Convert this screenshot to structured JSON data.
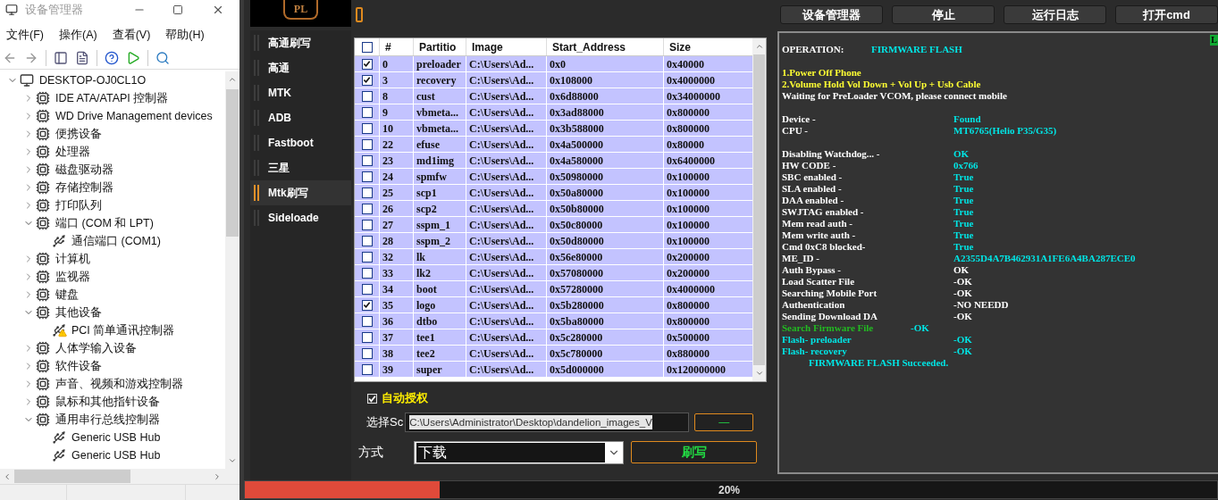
{
  "device_manager": {
    "title": "设备管理器",
    "menu": [
      "文件(F)",
      "操作(A)",
      "查看(V)",
      "帮助(H)"
    ],
    "tree": [
      {
        "label": "DESKTOP-OJ0CL1O",
        "kind": "root",
        "expanded": true,
        "children": [
          {
            "label": "IDE ATA/ATAPI 控制器",
            "kind": "group",
            "expanded": false
          },
          {
            "label": "WD Drive Management devices",
            "kind": "group",
            "expanded": false
          },
          {
            "label": "便携设备",
            "kind": "group",
            "expanded": false
          },
          {
            "label": "处理器",
            "kind": "group",
            "expanded": false
          },
          {
            "label": "磁盘驱动器",
            "kind": "group",
            "expanded": false
          },
          {
            "label": "存储控制器",
            "kind": "group",
            "expanded": false
          },
          {
            "label": "打印队列",
            "kind": "group",
            "expanded": false
          },
          {
            "label": "端口 (COM 和 LPT)",
            "kind": "group",
            "expanded": true,
            "children": [
              {
                "label": "通信端口 (COM1)",
                "kind": "device",
                "warning": false
              }
            ]
          },
          {
            "label": "计算机",
            "kind": "group",
            "expanded": false
          },
          {
            "label": "监视器",
            "kind": "group",
            "expanded": false
          },
          {
            "label": "键盘",
            "kind": "group",
            "expanded": false
          },
          {
            "label": "其他设备",
            "kind": "group",
            "expanded": true,
            "children": [
              {
                "label": "PCI 简单通讯控制器",
                "kind": "device",
                "warning": true
              }
            ]
          },
          {
            "label": "人体学输入设备",
            "kind": "group",
            "expanded": false
          },
          {
            "label": "软件设备",
            "kind": "group",
            "expanded": false
          },
          {
            "label": "声音、视频和游戏控制器",
            "kind": "group",
            "expanded": false
          },
          {
            "label": "鼠标和其他指针设备",
            "kind": "group",
            "expanded": false
          },
          {
            "label": "通用串行总线控制器",
            "kind": "group",
            "expanded": true,
            "children": [
              {
                "label": "Generic USB Hub",
                "kind": "device",
                "warning": false
              },
              {
                "label": "Generic USB Hub",
                "kind": "device",
                "warning": false
              }
            ]
          }
        ]
      }
    ]
  },
  "tool": {
    "logo": "PL",
    "toolbar": [
      "设备管理器",
      "停止",
      "运行日志",
      "打开cmd"
    ],
    "nav": [
      {
        "label": "高通刷写",
        "selected": false
      },
      {
        "label": "高通",
        "selected": false
      },
      {
        "label": "MTK",
        "selected": false
      },
      {
        "label": "ADB",
        "selected": false
      },
      {
        "label": "Fastboot",
        "selected": false
      },
      {
        "label": "三星",
        "selected": false
      },
      {
        "label": "Mtk刷写",
        "selected": true
      },
      {
        "label": "Sideloade",
        "selected": false
      }
    ],
    "table": {
      "select_all": false,
      "columns": [
        "#",
        "Partitio",
        "Image",
        "Start_Address",
        "Size"
      ],
      "rows": [
        {
          "checked": true,
          "cells": [
            "0",
            "preloader",
            "C:\\Users\\Ad...",
            "0x0",
            "0x40000"
          ]
        },
        {
          "checked": true,
          "cells": [
            "3",
            "recovery",
            "C:\\Users\\Ad...",
            "0x108000",
            "0x4000000"
          ]
        },
        {
          "checked": false,
          "cells": [
            "8",
            "cust",
            "C:\\Users\\Ad...",
            "0x6d88000",
            "0x34000000"
          ]
        },
        {
          "checked": false,
          "cells": [
            "9",
            "vbmeta...",
            "C:\\Users\\Ad...",
            "0x3ad88000",
            "0x800000"
          ]
        },
        {
          "checked": false,
          "cells": [
            "10",
            "vbmeta...",
            "C:\\Users\\Ad...",
            "0x3b588000",
            "0x800000"
          ]
        },
        {
          "checked": false,
          "cells": [
            "22",
            "efuse",
            "C:\\Users\\Ad...",
            "0x4a500000",
            "0x80000"
          ]
        },
        {
          "checked": false,
          "cells": [
            "23",
            "md1img",
            "C:\\Users\\Ad...",
            "0x4a580000",
            "0x6400000"
          ]
        },
        {
          "checked": false,
          "cells": [
            "24",
            "spmfw",
            "C:\\Users\\Ad...",
            "0x50980000",
            "0x100000"
          ]
        },
        {
          "checked": false,
          "cells": [
            "25",
            "scp1",
            "C:\\Users\\Ad...",
            "0x50a80000",
            "0x100000"
          ]
        },
        {
          "checked": false,
          "cells": [
            "26",
            "scp2",
            "C:\\Users\\Ad...",
            "0x50b80000",
            "0x100000"
          ]
        },
        {
          "checked": false,
          "cells": [
            "27",
            "sspm_1",
            "C:\\Users\\Ad...",
            "0x50c80000",
            "0x100000"
          ]
        },
        {
          "checked": false,
          "cells": [
            "28",
            "sspm_2",
            "C:\\Users\\Ad...",
            "0x50d80000",
            "0x100000"
          ]
        },
        {
          "checked": false,
          "cells": [
            "32",
            "lk",
            "C:\\Users\\Ad...",
            "0x56e80000",
            "0x200000"
          ]
        },
        {
          "checked": false,
          "cells": [
            "33",
            "lk2",
            "C:\\Users\\Ad...",
            "0x57080000",
            "0x200000"
          ]
        },
        {
          "checked": false,
          "cells": [
            "34",
            "boot",
            "C:\\Users\\Ad...",
            "0x57280000",
            "0x4000000"
          ]
        },
        {
          "checked": true,
          "cells": [
            "35",
            "logo",
            "C:\\Users\\Ad...",
            "0x5b280000",
            "0x800000"
          ]
        },
        {
          "checked": false,
          "cells": [
            "36",
            "dtbo",
            "C:\\Users\\Ad...",
            "0x5ba80000",
            "0x800000"
          ]
        },
        {
          "checked": false,
          "cells": [
            "37",
            "tee1",
            "C:\\Users\\Ad...",
            "0x5c280000",
            "0x500000"
          ]
        },
        {
          "checked": false,
          "cells": [
            "38",
            "tee2",
            "C:\\Users\\Ad...",
            "0x5c780000",
            "0x880000"
          ]
        },
        {
          "checked": false,
          "cells": [
            "39",
            "super",
            "C:\\Users\\Ad...",
            "0x5d000000",
            "0x120000000"
          ]
        }
      ]
    },
    "auto_auth": {
      "label": "自动授权",
      "checked": true
    },
    "scatter": {
      "label": "选择Sc",
      "value": "C:\\Users\\Administrator\\Desktop\\dandelion_images_V",
      "button": "—"
    },
    "mode": {
      "label": "方式",
      "value": "下载",
      "button": "刷写"
    },
    "progress": {
      "level": 0.2,
      "label": "20%"
    },
    "log": {
      "badge": "L",
      "blocks": [
        [
          {
            "kind": "head",
            "label": {
              "text": "OPERATION:",
              "color": "#ffffff"
            },
            "value": {
              "text": "FIRMWARE FLASH",
              "color": "#00e5e5"
            }
          }
        ],
        [
          {
            "kind": "text",
            "label": {
              "text": "1.Power Off Phone",
              "color": "#ffff33"
            }
          },
          {
            "kind": "text",
            "label": {
              "text": "2.Volume Hold Vol Down + Vol Up + Usb Cable",
              "color": "#ffff33"
            }
          },
          {
            "kind": "text",
            "label": {
              "text": "Waiting for PreLoader VCOM, please connect mobile",
              "color": "#ffffff"
            }
          }
        ],
        [
          {
            "kind": "pair",
            "label": {
              "text": "Device -",
              "color": "#ffffff"
            },
            "value": {
              "text": "Found",
              "color": "#00e5e5"
            }
          },
          {
            "kind": "pair",
            "label": {
              "text": "CPU -",
              "color": "#ffffff"
            },
            "value": {
              "text": "MT6765(Helio P35/G35)",
              "color": "#00e5e5"
            }
          }
        ],
        [
          {
            "kind": "pair",
            "label": {
              "text": "Disabling Watchdog... -",
              "color": "#ffffff"
            },
            "value": {
              "text": "OK",
              "color": "#00e5e5"
            }
          },
          {
            "kind": "pair",
            "label": {
              "text": "HW CODE -",
              "color": "#ffffff"
            },
            "value": {
              "text": "0x766",
              "color": "#00e5e5"
            }
          },
          {
            "kind": "pair",
            "label": {
              "text": "SBC enabled -",
              "color": "#ffffff"
            },
            "value": {
              "text": "True",
              "color": "#00e5e5"
            }
          },
          {
            "kind": "pair",
            "label": {
              "text": "SLA enabled -",
              "color": "#ffffff"
            },
            "value": {
              "text": "True",
              "color": "#00e5e5"
            }
          },
          {
            "kind": "pair",
            "label": {
              "text": "DAA enabled -",
              "color": "#ffffff"
            },
            "value": {
              "text": "True",
              "color": "#00e5e5"
            }
          },
          {
            "kind": "pair",
            "label": {
              "text": "SWJTAG enabled -",
              "color": "#ffffff"
            },
            "value": {
              "text": "True",
              "color": "#00e5e5"
            }
          },
          {
            "kind": "pair",
            "label": {
              "text": "Mem read auth -",
              "color": "#ffffff"
            },
            "value": {
              "text": "True",
              "color": "#00e5e5"
            }
          },
          {
            "kind": "pair",
            "label": {
              "text": "Mem write auth -",
              "color": "#ffffff"
            },
            "value": {
              "text": "True",
              "color": "#00e5e5"
            }
          },
          {
            "kind": "pair",
            "label": {
              "text": "Cmd 0xC8 blocked-",
              "color": "#ffffff"
            },
            "value": {
              "text": "True",
              "color": "#00e5e5"
            }
          },
          {
            "kind": "pair",
            "label": {
              "text": "ME_ID -",
              "color": "#ffffff"
            },
            "value": {
              "text": "A2355D4A7B462931A1FE6A4BA287ECE0",
              "color": "#00e5e5"
            }
          },
          {
            "kind": "pair",
            "label": {
              "text": "Auth Bypass -",
              "color": "#ffffff"
            },
            "value": {
              "text": "OK",
              "color": "#ffffff"
            }
          },
          {
            "kind": "pair",
            "label": {
              "text": "Load Scatter File",
              "color": "#ffffff"
            },
            "value": {
              "text": "-OK",
              "color": "#ffffff"
            }
          },
          {
            "kind": "pair",
            "label": {
              "text": "Searching Mobile Port",
              "color": "#ffffff"
            },
            "value": {
              "text": "-OK",
              "color": "#ffffff"
            }
          },
          {
            "kind": "pair",
            "label": {
              "text": "Authentication",
              "color": "#ffffff"
            },
            "value": {
              "text": "-NO NEEDD",
              "color": "#ffffff"
            }
          },
          {
            "kind": "pair",
            "label": {
              "text": "Sending Download DA",
              "color": "#ffffff"
            },
            "value": {
              "text": "-OK",
              "color": "#ffffff"
            }
          },
          {
            "kind": "near",
            "label": {
              "text": "Search Firmware File",
              "color": "#22bb22"
            },
            "value": {
              "text": "-OK",
              "color": "#00e5e5"
            }
          },
          {
            "kind": "pair",
            "label": {
              "text": "Flash- preloader",
              "color": "#00e5e5"
            },
            "value": {
              "text": "-OK",
              "color": "#00e5e5"
            }
          },
          {
            "kind": "pair",
            "label": {
              "text": "Flash- recovery",
              "color": "#00e5e5"
            },
            "value": {
              "text": "-OK",
              "color": "#00e5e5"
            }
          },
          {
            "kind": "indent",
            "label": {
              "text": "FIRMWARE FLASH Succeeded.",
              "color": "#00e5e5"
            }
          }
        ]
      ]
    }
  }
}
